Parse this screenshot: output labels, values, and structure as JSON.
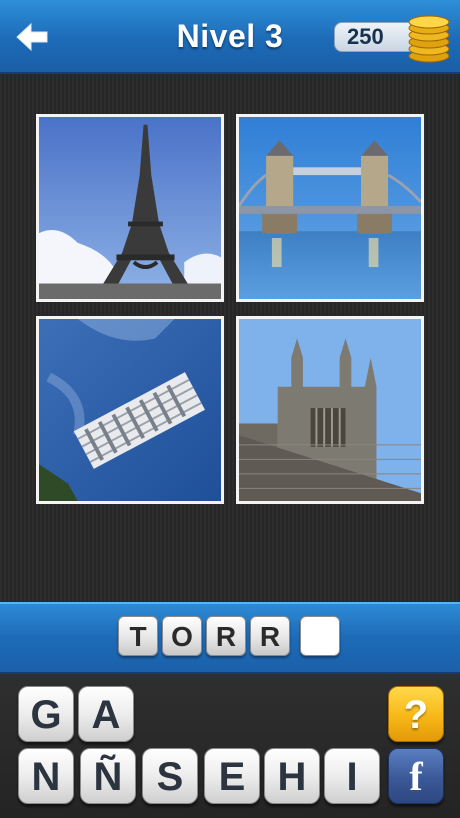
{
  "header": {
    "back_icon": "back-arrow-icon",
    "title": "Nivel 3",
    "score": "250",
    "coins_icon": "gold-coins-icon"
  },
  "photos": [
    {
      "subject": "eiffel-tower-photo"
    },
    {
      "subject": "tower-bridge-photo"
    },
    {
      "subject": "leaning-tower-pisa-photo"
    },
    {
      "subject": "church-tower-photo"
    }
  ],
  "answer": {
    "letters": [
      "T",
      "O",
      "R",
      "R",
      ""
    ]
  },
  "keyboard": {
    "row1": [
      "G",
      "A"
    ],
    "row2": [
      "N",
      "Ñ",
      "S",
      "E",
      "H",
      "I"
    ],
    "hint_label": "?",
    "facebook_label": "f"
  },
  "colors": {
    "bar_blue": "#1d6bb8",
    "hint_yellow": "#f7b817",
    "facebook_blue": "#3b5998"
  }
}
